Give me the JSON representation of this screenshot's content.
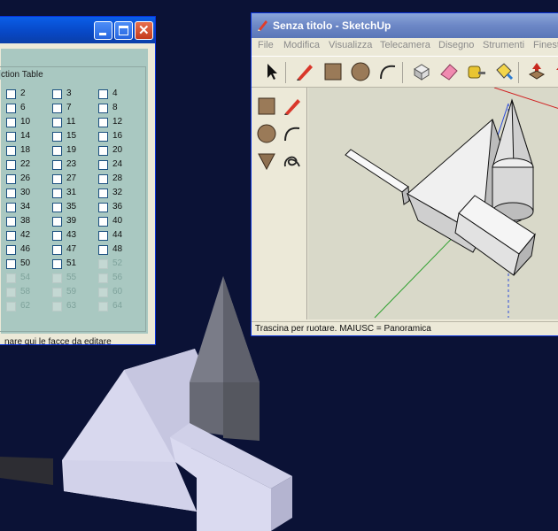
{
  "dialog": {
    "group_label": "ction Table",
    "items": [
      {
        "n": "2",
        "enabled": true
      },
      {
        "n": "3",
        "enabled": true
      },
      {
        "n": "4",
        "enabled": true
      },
      {
        "n": "6",
        "enabled": true
      },
      {
        "n": "7",
        "enabled": true
      },
      {
        "n": "8",
        "enabled": true
      },
      {
        "n": "10",
        "enabled": true
      },
      {
        "n": "11",
        "enabled": true
      },
      {
        "n": "12",
        "enabled": true
      },
      {
        "n": "14",
        "enabled": true
      },
      {
        "n": "15",
        "enabled": true
      },
      {
        "n": "16",
        "enabled": true
      },
      {
        "n": "18",
        "enabled": true
      },
      {
        "n": "19",
        "enabled": true
      },
      {
        "n": "20",
        "enabled": true
      },
      {
        "n": "22",
        "enabled": true
      },
      {
        "n": "23",
        "enabled": true
      },
      {
        "n": "24",
        "enabled": true
      },
      {
        "n": "26",
        "enabled": true
      },
      {
        "n": "27",
        "enabled": true
      },
      {
        "n": "28",
        "enabled": true
      },
      {
        "n": "30",
        "enabled": true
      },
      {
        "n": "31",
        "enabled": true
      },
      {
        "n": "32",
        "enabled": true
      },
      {
        "n": "34",
        "enabled": true
      },
      {
        "n": "35",
        "enabled": true
      },
      {
        "n": "36",
        "enabled": true
      },
      {
        "n": "38",
        "enabled": true
      },
      {
        "n": "39",
        "enabled": true
      },
      {
        "n": "40",
        "enabled": true
      },
      {
        "n": "42",
        "enabled": true
      },
      {
        "n": "43",
        "enabled": true
      },
      {
        "n": "44",
        "enabled": true
      },
      {
        "n": "46",
        "enabled": true
      },
      {
        "n": "47",
        "enabled": true
      },
      {
        "n": "48",
        "enabled": true
      },
      {
        "n": "50",
        "enabled": true
      },
      {
        "n": "51",
        "enabled": true
      },
      {
        "n": "52",
        "enabled": false
      },
      {
        "n": "54",
        "enabled": false
      },
      {
        "n": "55",
        "enabled": false
      },
      {
        "n": "56",
        "enabled": false
      },
      {
        "n": "58",
        "enabled": false
      },
      {
        "n": "59",
        "enabled": false
      },
      {
        "n": "60",
        "enabled": false
      },
      {
        "n": "62",
        "enabled": false
      },
      {
        "n": "63",
        "enabled": false
      },
      {
        "n": "64",
        "enabled": false
      }
    ],
    "footnote": "nare qui le facce da editare"
  },
  "sketchup": {
    "title": "Senza titolo - SketchUp",
    "menu": [
      "File",
      "Modifica",
      "Visualizza",
      "Telecamera",
      "Disegno",
      "Strumenti",
      "Finestra"
    ],
    "toolbar_icons": [
      "select-arrow-icon",
      "pencil-icon",
      "rectangle-icon",
      "circle-icon",
      "arc-icon",
      "push-pull-icon",
      "eraser-icon",
      "tape-measure-icon",
      "paint-bucket-icon",
      "move-icon",
      "rotate-icon"
    ],
    "side_icons": [
      "rectangle-icon",
      "pencil-icon",
      "circle-icon",
      "arc-icon",
      "push-pull-icon",
      "freehand-icon"
    ],
    "status": "Trascina per ruotare. MAIUSC = Panoramica"
  },
  "colors": {
    "desktop": "#0b1236",
    "xp_blue": "#0a5ee8",
    "inactive_title": "#7b95cd",
    "dialog_panel": "#a9c8c1",
    "viewport": "#d9d9c9"
  }
}
